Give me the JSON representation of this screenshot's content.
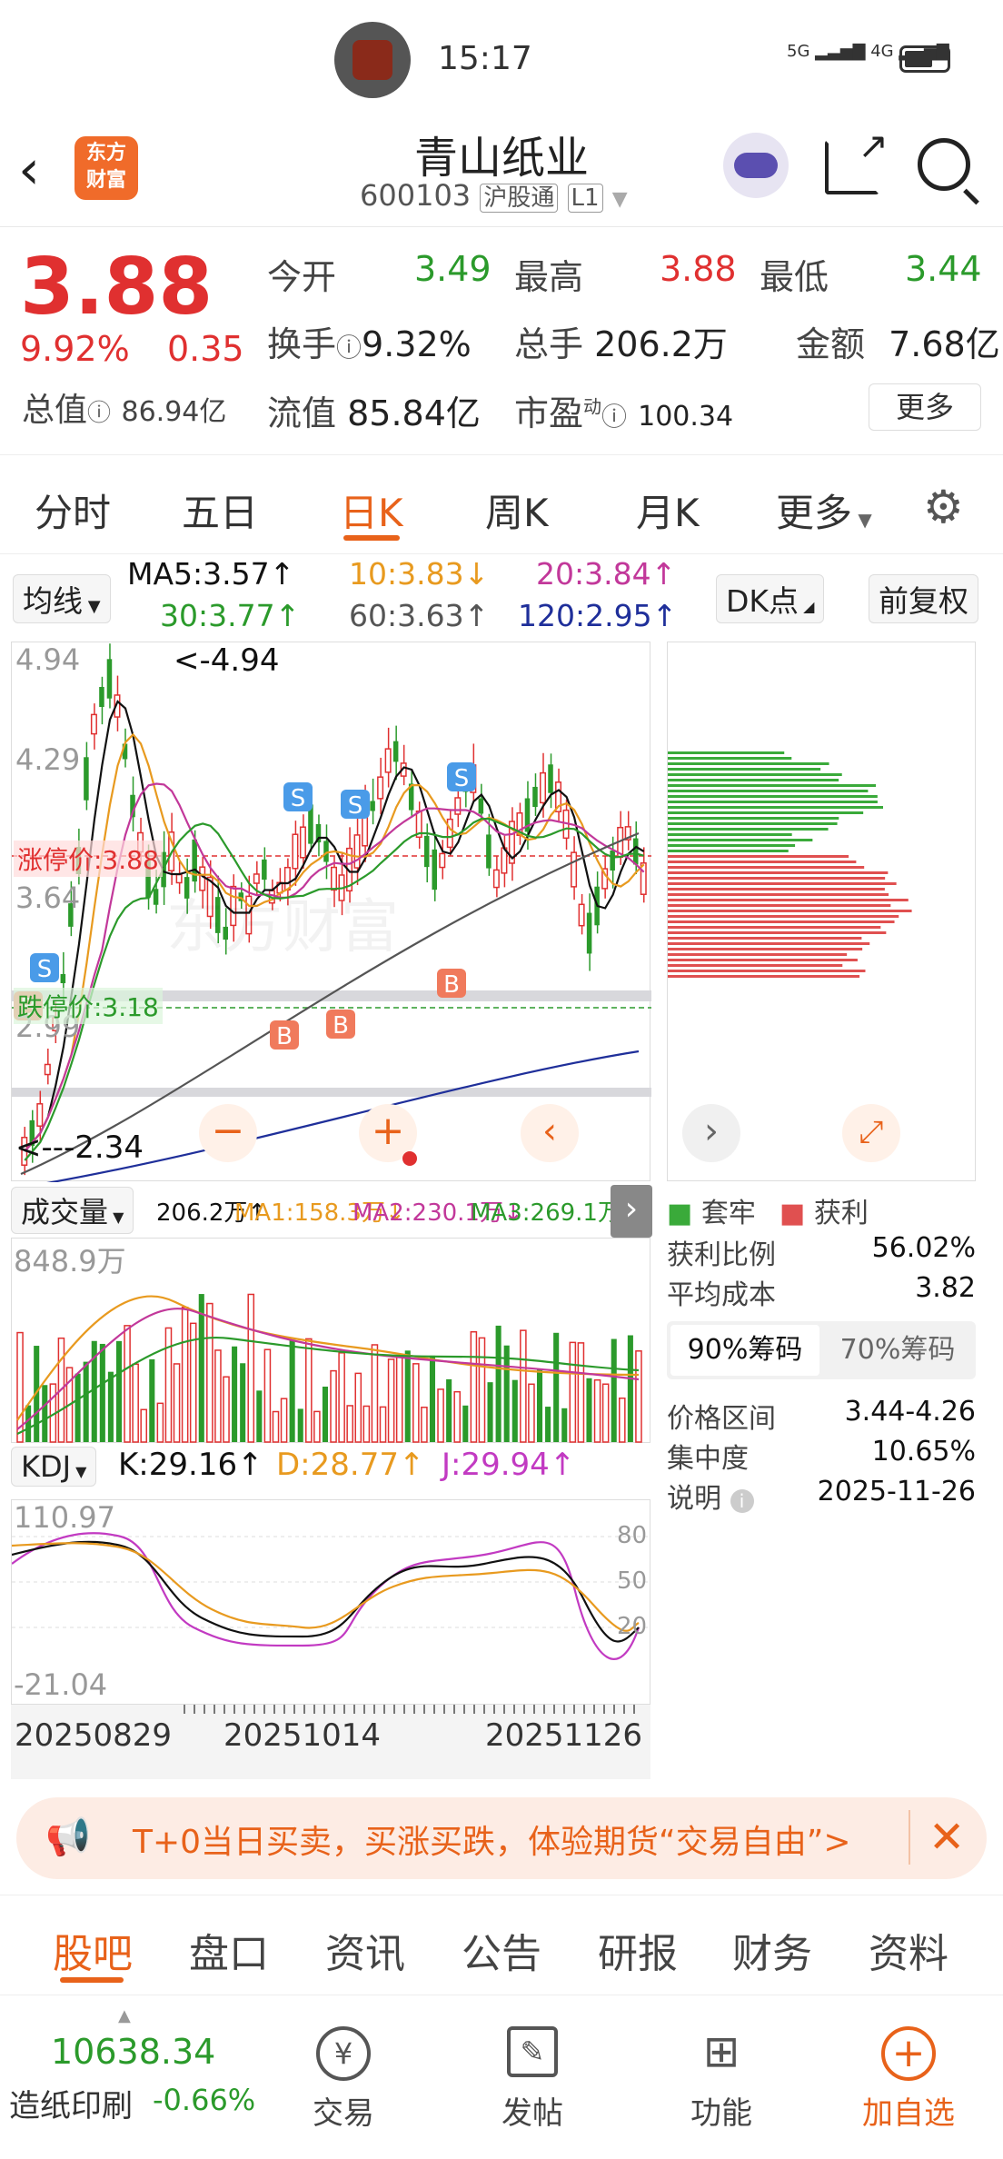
{
  "status": {
    "time": "15:17",
    "signal1": "5G",
    "signal2": "4G"
  },
  "header": {
    "logo_line1": "东方",
    "logo_line2": "财富",
    "stock_name": "青山纸业",
    "stock_code": "600103",
    "tag_hgt": "沪股通",
    "tag_l1": "L1"
  },
  "quote": {
    "price": "3.88",
    "change_pct": "9.92%",
    "change": "0.35",
    "open_label": "今开",
    "open": "3.49",
    "high_label": "最高",
    "high": "3.88",
    "low_label": "最低",
    "low": "3.44",
    "turnover_label": "换手",
    "turnover": "9.32%",
    "volume_label": "总手",
    "volume": "206.2万",
    "amount_label": "金额",
    "amount": "7.68亿",
    "mktcap_label": "总值",
    "mktcap": "86.94亿",
    "float_label": "流值",
    "float": "85.84亿",
    "pe_label": "市盈",
    "pe_sup": "动",
    "pe": "100.34",
    "more": "更多"
  },
  "tabs": [
    "分时",
    "五日",
    "日K",
    "周K",
    "月K",
    "更多"
  ],
  "ma_bar": {
    "selector": "均线",
    "ma5": "MA5:3.57↑",
    "ma10": "10:3.83↓",
    "ma20": "20:3.84↑",
    "ma30": "30:3.77↑",
    "ma60": "60:3.63↑",
    "ma120": "120:2.95↑",
    "dk": "DK点",
    "fq": "前复权"
  },
  "kline": {
    "y_labels": [
      "4.94",
      "4.29",
      "3.64",
      "2.99"
    ],
    "high_mark": "<-4.94",
    "low_mark": "<---2.34",
    "limit_up": "涨停价:3.88",
    "limit_down": "跌停价:3.18",
    "watermark": "东方财富",
    "signals": {
      "s": "S",
      "b": "B"
    }
  },
  "volume": {
    "selector": "成交量",
    "vol": "206.2万↑",
    "ma1": "MA1:158.3万↓",
    "ma2": "MA2:230.1万↓",
    "ma3": "MA3:269.1万↓",
    "ymax": "848.9万"
  },
  "kdj": {
    "selector": "KDJ",
    "k": "K:29.16↑",
    "d": "D:28.77↑",
    "j": "J:29.94↑",
    "ytop": "110.97",
    "ybot": "-21.04",
    "g80": "80",
    "g50": "50",
    "g20": "20"
  },
  "dates": [
    "20250829",
    "20251014",
    "20251126"
  ],
  "chips": {
    "legend_trapped": "套牢",
    "legend_profit": "获利",
    "rows": [
      {
        "k": "获利比例",
        "v": "56.02%"
      },
      {
        "k": "平均成本",
        "v": "3.82"
      }
    ],
    "tab_90": "90%筹码",
    "tab_70": "70%筹码",
    "rows2": [
      {
        "k": "价格区间",
        "v": "3.44-4.26"
      },
      {
        "k": "集中度",
        "v": "10.65%"
      },
      {
        "k": "说明",
        "v": "2025-11-26"
      }
    ]
  },
  "banner": "T+0当日买卖，买涨买跌，体验期货“交易自由”>",
  "bottom_tabs": [
    "股吧",
    "盘口",
    "资讯",
    "公告",
    "研报",
    "财务",
    "资料"
  ],
  "dock": {
    "index_value": "10638.34",
    "index_name": "造纸印刷",
    "index_change": "-0.66%",
    "items": [
      "交易",
      "发帖",
      "功能",
      "加自选"
    ]
  },
  "colors": {
    "up": "#e03030",
    "down": "#2b9a2b",
    "accent": "#e8621a"
  }
}
